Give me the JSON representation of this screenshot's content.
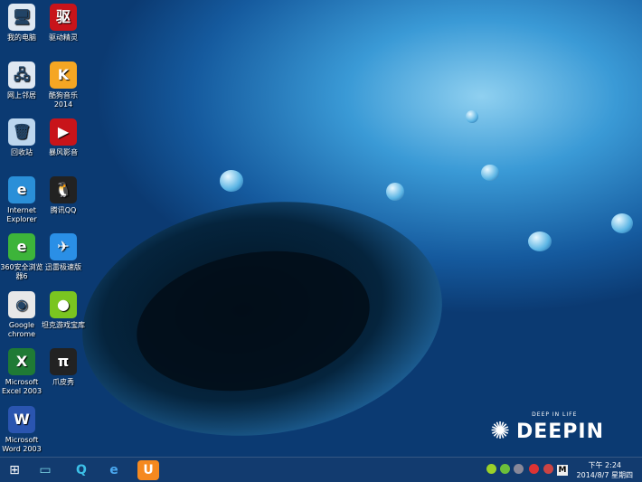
{
  "desktop": {
    "icons": [
      {
        "label": "我的电脑",
        "glyph": "🖥",
        "bg": "#dfe8f2"
      },
      {
        "label": "驱动精灵",
        "glyph": "驱",
        "bg": "#c8141a"
      },
      {
        "label": "网上邻居",
        "glyph": "🖧",
        "bg": "#dfe8f2"
      },
      {
        "label": "酷狗音乐 2014",
        "glyph": "K",
        "bg": "#f5a623"
      },
      {
        "label": "回收站",
        "glyph": "🗑",
        "bg": "#bcd6ee"
      },
      {
        "label": "暴风影音",
        "glyph": "▶",
        "bg": "#c8141a"
      },
      {
        "label": "Internet Explorer",
        "glyph": "e",
        "bg": "#2a8fd8"
      },
      {
        "label": "腾讯QQ",
        "glyph": "🐧",
        "bg": "#222"
      },
      {
        "label": "360安全浏览器6",
        "glyph": "e",
        "bg": "#3db43a"
      },
      {
        "label": "迅雷极速版",
        "glyph": "✈",
        "bg": "#2a8fe6"
      },
      {
        "label": "Google chrome",
        "glyph": "◉",
        "bg": "#e8e8e8"
      },
      {
        "label": "坦克游戏宝库",
        "glyph": "●",
        "bg": "#7ac520"
      },
      {
        "label": "Microsoft Excel 2003",
        "glyph": "X",
        "bg": "#1f7a35"
      },
      {
        "label": "爪皮秀",
        "glyph": "π",
        "bg": "#222"
      },
      {
        "label": "Microsoft Word 2003",
        "glyph": "W",
        "bg": "#2a55b0"
      }
    ]
  },
  "brand": {
    "tagline": "DEEP IN LIFE",
    "name": "DEEPIN"
  },
  "taskbar": {
    "start": "⊞",
    "apps": [
      {
        "name": "store",
        "glyph": "▭"
      },
      {
        "name": "qq-browser",
        "glyph": "Q"
      },
      {
        "name": "ie",
        "glyph": "e"
      },
      {
        "name": "uc-browser",
        "glyph": "U"
      }
    ],
    "clock": {
      "time": "下午 2:24",
      "date": "2014/8/7 星期四"
    },
    "tray_m": "M"
  }
}
